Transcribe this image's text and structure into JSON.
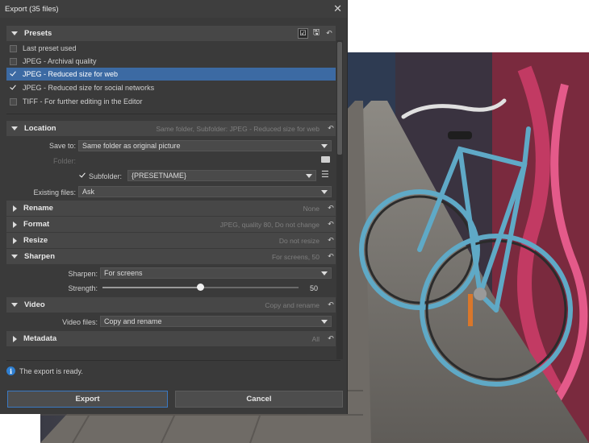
{
  "window": {
    "title": "Export (35 files)"
  },
  "presets": {
    "label": "Presets",
    "items": [
      {
        "label": "Last preset used",
        "checked": false,
        "selected": false
      },
      {
        "label": "JPEG - Archival quality",
        "checked": false,
        "selected": false
      },
      {
        "label": "JPEG - Reduced size for web",
        "checked": true,
        "selected": true
      },
      {
        "label": "JPEG - Reduced size for social networks",
        "checked": true,
        "selected": false
      },
      {
        "label": "TIFF - For further editing in the Editor",
        "checked": false,
        "selected": false
      }
    ]
  },
  "location": {
    "label": "Location",
    "summary": "Same folder, Subfolder: JPEG - Reduced size for web",
    "save_to_label": "Save to:",
    "save_to_value": "Same folder as original picture",
    "folder_label": "Folder:",
    "subfolder_label": "Subfolder:",
    "subfolder_checked": true,
    "subfolder_value": "{PRESETNAME}",
    "existing_label": "Existing files:",
    "existing_value": "Ask"
  },
  "rename": {
    "label": "Rename",
    "summary": "None"
  },
  "format": {
    "label": "Format",
    "summary": "JPEG, quality 80, Do not change"
  },
  "resize": {
    "label": "Resize",
    "summary": "Do not resize"
  },
  "sharpen": {
    "label": "Sharpen",
    "summary": "For screens, 50",
    "sharpen_label": "Sharpen:",
    "sharpen_value": "For screens",
    "strength_label": "Strength:",
    "strength_value": "50",
    "strength_fraction": 0.5
  },
  "video": {
    "label": "Video",
    "summary": "Copy and rename",
    "files_label": "Video files:",
    "files_value": "Copy and rename"
  },
  "metadata": {
    "label": "Metadata",
    "summary": "All"
  },
  "status": {
    "text": "The export is ready."
  },
  "buttons": {
    "export": "Export",
    "cancel": "Cancel"
  },
  "colors": {
    "dialog_bg": "#3a3a3a",
    "selection": "#3c6aa3",
    "info": "#2f7fd1",
    "bike": "#5fa9c6"
  }
}
